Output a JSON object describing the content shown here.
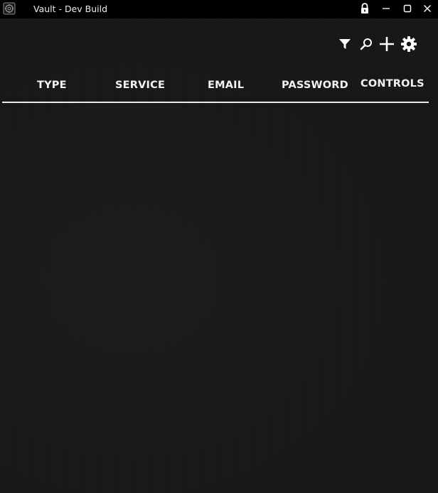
{
  "window": {
    "title": "Vault - Dev Build",
    "controls": {
      "lock": "lock-icon",
      "minimize": "minimize-icon",
      "maximize": "maximize-icon",
      "close": "close-icon"
    }
  },
  "toolbar": {
    "icons": [
      "filter-icon",
      "search-icon",
      "add-icon",
      "gear-icon"
    ]
  },
  "table": {
    "columns": [
      "TYPE",
      "SERVICE",
      "EMAIL",
      "PASSWORD",
      "CONTROLS"
    ],
    "rows": []
  },
  "colors": {
    "background": "#171717",
    "titlebar": "#000000",
    "text": "#f2f2f2",
    "divider": "#e8e8e8"
  }
}
